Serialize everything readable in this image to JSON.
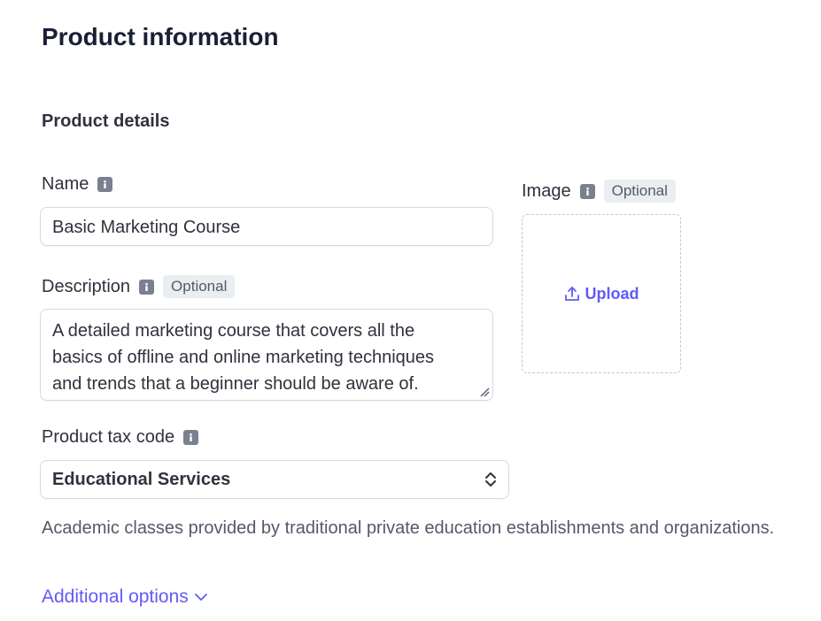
{
  "page_title": "Product information",
  "section_title": "Product details",
  "name_field": {
    "label": "Name",
    "value": "Basic Marketing Course"
  },
  "description_field": {
    "label": "Description",
    "badge": "Optional",
    "lines": [
      "A detailed marketing course that covers all the",
      "basics of offline and online marketing techniques",
      "and trends that a beginner should be aware of."
    ]
  },
  "tax_code_field": {
    "label": "Product tax code",
    "selected": "Educational Services",
    "helper_text": "Academic classes provided by traditional private education establishments and organizations."
  },
  "image_field": {
    "label": "Image",
    "badge": "Optional",
    "upload_label": "Upload"
  },
  "additional_options": {
    "label": "Additional options"
  },
  "colors": {
    "accent": "#625afa",
    "text": "#30313d",
    "muted": "#545969",
    "border": "#d5dbe1"
  }
}
